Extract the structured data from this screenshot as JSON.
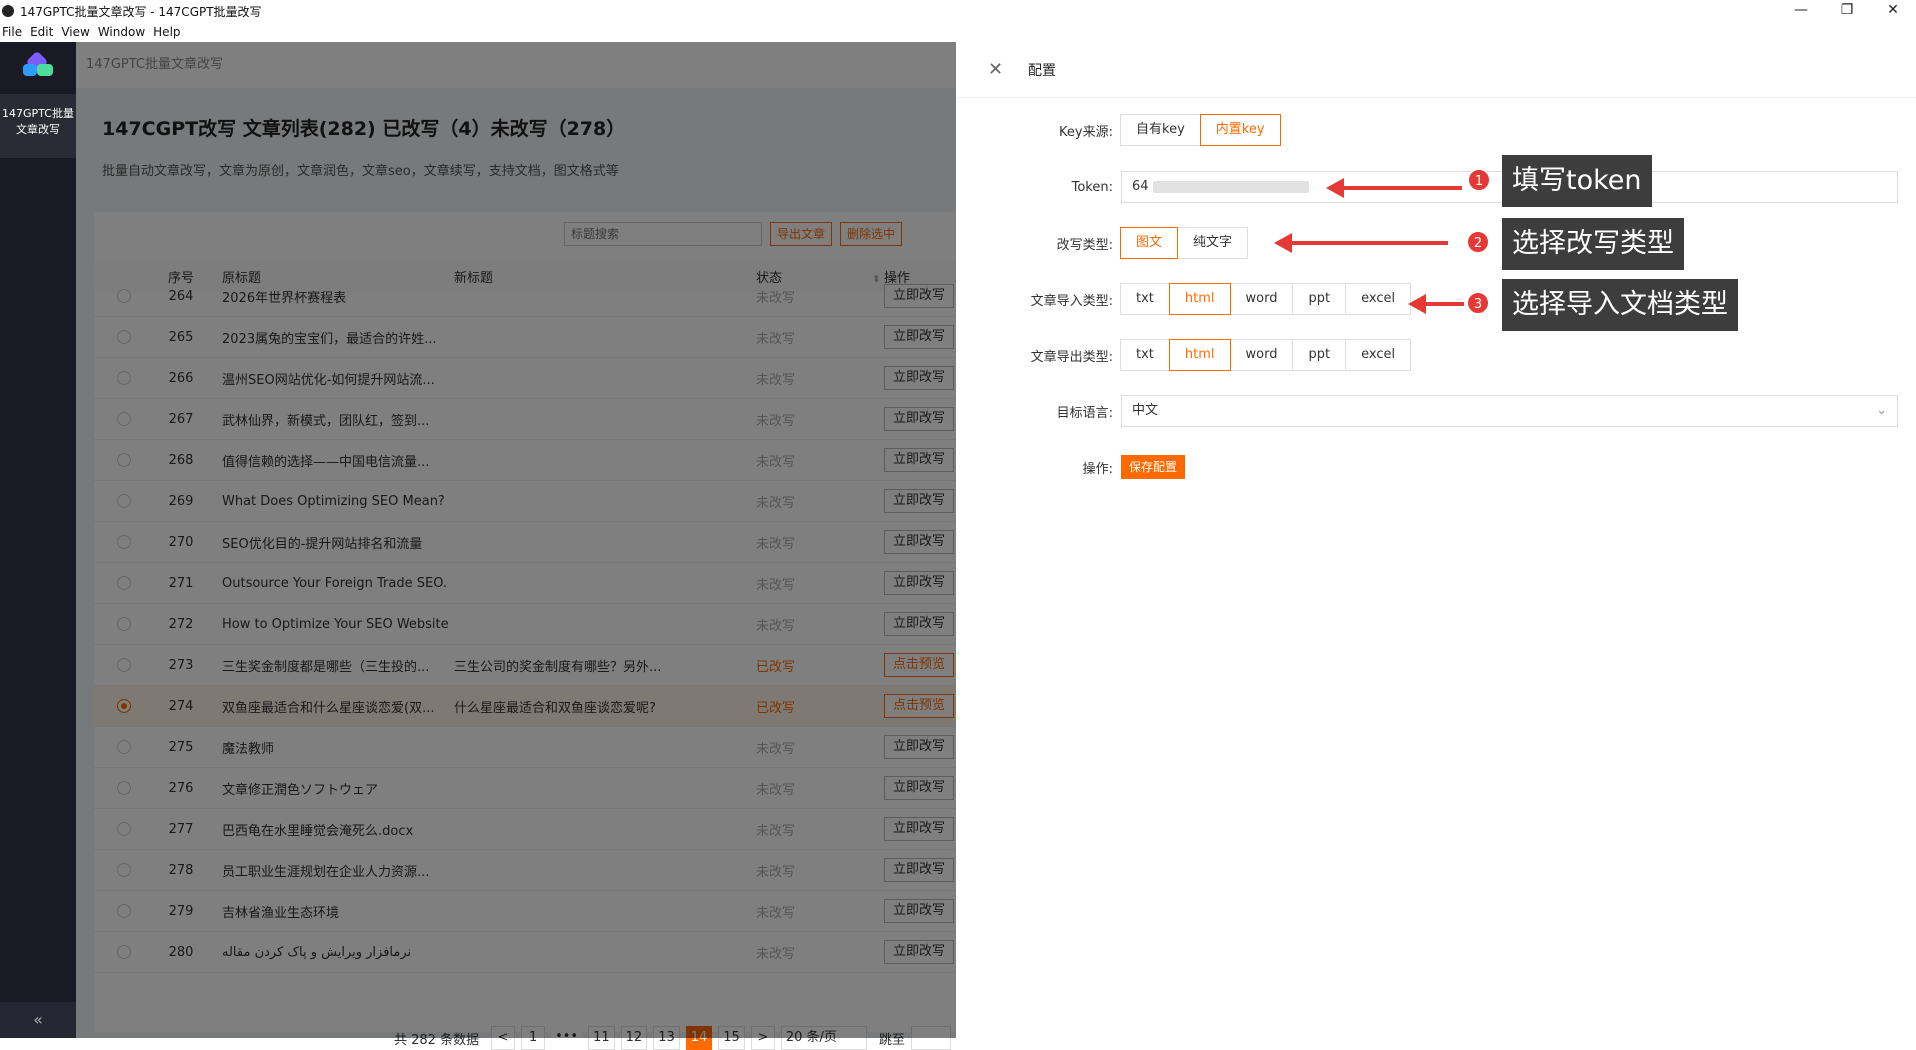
{
  "window": {
    "title": "147GPTC批量文章改写 - 147CGPT批量改写",
    "menu": [
      "File",
      "Edit",
      "View",
      "Window",
      "Help"
    ],
    "controls": [
      "—",
      "❐",
      "✕"
    ]
  },
  "nav": {
    "item_label_1": "147GPTC批量",
    "item_label_2": "文章改写",
    "collapse": "«"
  },
  "app": {
    "header": "147GPTC批量文章改写",
    "title": "147CGPT改写 文章列表(282) 已改写（4）未改写（278）",
    "description": "批量自动文章改写，文章为原创，文章润色，文章seo，文章续写，支持文档，图文格式等",
    "search_placeholder": "标题搜索",
    "export_label": "导出文章",
    "delete_label": "删除选中"
  },
  "table": {
    "headers": {
      "no": "序号",
      "orig": "原标题",
      "new": "新标题",
      "status": "状态",
      "op": "操作"
    },
    "rows": [
      {
        "no": "264",
        "orig": "2026年世界杯赛程表",
        "new": "",
        "status": "未改写",
        "op": "立即改写"
      },
      {
        "no": "265",
        "orig": "2023属兔的宝宝们，最适合的许姓...",
        "new": "",
        "status": "未改写",
        "op": "立即改写"
      },
      {
        "no": "266",
        "orig": "温州SEO网站优化-如何提升网站流...",
        "new": "",
        "status": "未改写",
        "op": "立即改写"
      },
      {
        "no": "267",
        "orig": "武林仙界，新模式，团队红，签到...",
        "new": "",
        "status": "未改写",
        "op": "立即改写"
      },
      {
        "no": "268",
        "orig": "值得信赖的选择——中国电信流量...",
        "new": "",
        "status": "未改写",
        "op": "立即改写"
      },
      {
        "no": "269",
        "orig": "What Does Optimizing SEO Mean?",
        "new": "",
        "status": "未改写",
        "op": "立即改写"
      },
      {
        "no": "270",
        "orig": "SEO优化目的-提升网站排名和流量",
        "new": "",
        "status": "未改写",
        "op": "立即改写"
      },
      {
        "no": "271",
        "orig": "Outsource Your Foreign Trade SEO...",
        "new": "",
        "status": "未改写",
        "op": "立即改写"
      },
      {
        "no": "272",
        "orig": "How to Optimize Your SEO Website",
        "new": "",
        "status": "未改写",
        "op": "立即改写"
      },
      {
        "no": "273",
        "orig": "三生奖金制度都是哪些（三生投的...",
        "new": "三生公司的奖金制度有哪些？另外...",
        "status": "已改写",
        "op": "点击预览"
      },
      {
        "no": "274",
        "orig": "双鱼座最适合和什么星座谈恋爱(双...",
        "new": "什么星座最适合和双鱼座谈恋爱呢?",
        "status": "已改写",
        "op": "点击预览"
      },
      {
        "no": "275",
        "orig": "魔法教师",
        "new": "",
        "status": "未改写",
        "op": "立即改写"
      },
      {
        "no": "276",
        "orig": "文章修正潤色ソフトウェア",
        "new": "",
        "status": "未改写",
        "op": "立即改写"
      },
      {
        "no": "277",
        "orig": "巴西龟在水里睡觉会淹死么.docx",
        "new": "",
        "status": "未改写",
        "op": "立即改写"
      },
      {
        "no": "278",
        "orig": "员工职业生涯规划在企业人力资源...",
        "new": "",
        "status": "未改写",
        "op": "立即改写"
      },
      {
        "no": "279",
        "orig": "吉林省渔业生态环境",
        "new": "",
        "status": "未改写",
        "op": "立即改写"
      },
      {
        "no": "280",
        "orig": "نرمافزار ویرایش و پاک کردن مقاله",
        "new": "",
        "status": "未改写",
        "op": "立即改写"
      }
    ],
    "selected_row": "274"
  },
  "pager": {
    "total": "共 282 条数据",
    "prev": "<",
    "pages": [
      "1",
      "•••",
      "11",
      "12",
      "13",
      "14",
      "15"
    ],
    "current": "14",
    "next": ">",
    "size": "20 条/页",
    "jump": "跳至"
  },
  "drawer": {
    "title": "配置",
    "close": "✕",
    "key_source_label": "Key来源:",
    "key_source_options": [
      "自有key",
      "内置key"
    ],
    "key_source_selected": "内置key",
    "token_label": "Token:",
    "token_value_prefix": "64",
    "rewrite_type_label": "改写类型:",
    "rewrite_type_options": [
      "图文",
      "纯文字"
    ],
    "rewrite_type_selected": "图文",
    "import_label": "文章导入类型:",
    "import_options": [
      "txt",
      "html",
      "word",
      "ppt",
      "excel"
    ],
    "import_selected": "html",
    "export_label": "文章导出类型:",
    "export_options": [
      "txt",
      "html",
      "word",
      "ppt",
      "excel"
    ],
    "export_selected": "html",
    "lang_label": "目标语言:",
    "lang_value": "中文",
    "action_label": "操作:",
    "save_label": "保存配置"
  },
  "annotations": [
    {
      "num": "1",
      "text": "填写token"
    },
    {
      "num": "2",
      "text": "选择改写类型"
    },
    {
      "num": "3",
      "text": "选择导入文档类型"
    }
  ],
  "colors": {
    "accent": "#ff6a00",
    "annotation": "#e53935",
    "sidebar": "#1a1a24"
  }
}
